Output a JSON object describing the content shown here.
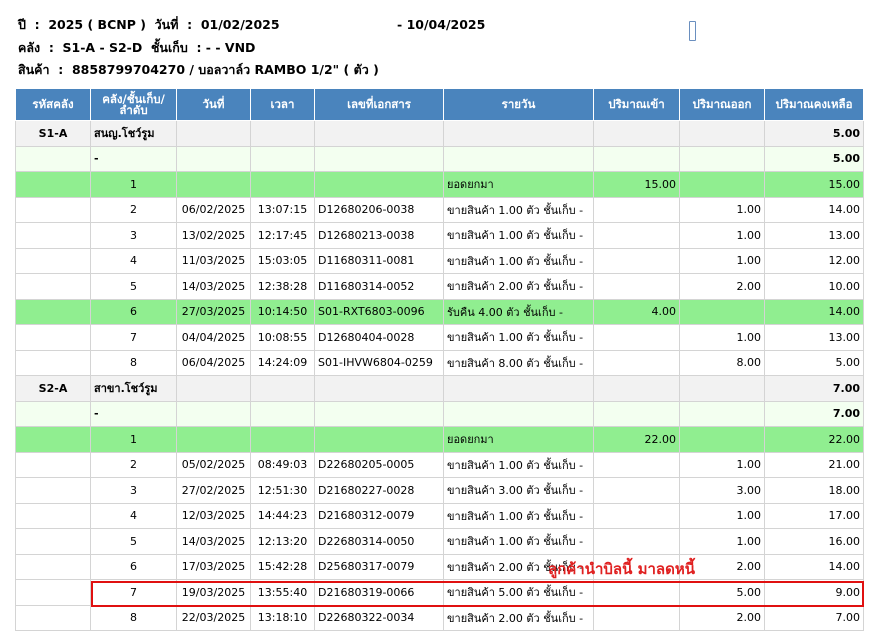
{
  "header": {
    "line1": "ปี  :  2025 ( BCNP )  วันที่  :  01/02/2025                           - 10/04/2025",
    "line2": "คลัง  :  S1-A - S2-D  ชั้นเก็บ  : - - VND",
    "line3": "สินค้า  :  8858799704270 / บอลวาล์ว RAMBO 1/2\" ( ตัว )"
  },
  "table": {
    "columns": [
      "รหัสคลัง",
      "คลัง/ชั้นเก็บ/ลำดับ",
      "วันที่",
      "เวลา",
      "เลขที่เอกสาร",
      "รายวัน",
      "ปริมาณเข้า",
      "ปริมาณออก",
      "ปริมาณคงเหลือ"
    ],
    "rows": [
      {
        "kind": "grp",
        "code": "S1-A",
        "loc": "สนญ.โชว์รูม",
        "date": "",
        "time": "",
        "doc": "",
        "desc": "",
        "in": "",
        "out": "",
        "bal": "5.00"
      },
      {
        "kind": "sub",
        "code": "",
        "loc": "-",
        "date": "",
        "time": "",
        "doc": "",
        "desc": "",
        "in": "",
        "out": "",
        "bal": "5.00"
      },
      {
        "kind": "open",
        "code": "",
        "loc": "1",
        "date": "",
        "time": "",
        "doc": "",
        "desc": "ยอดยกมา",
        "in": "15.00",
        "out": "",
        "bal": "15.00"
      },
      {
        "kind": "norm",
        "code": "",
        "loc": "2",
        "date": "06/02/2025",
        "time": "13:07:15",
        "doc": "D12680206-0038",
        "desc": "ขายสินค้า 1.00 ตัว ชั้นเก็บ -",
        "in": "",
        "out": "1.00",
        "bal": "14.00"
      },
      {
        "kind": "norm",
        "code": "",
        "loc": "3",
        "date": "13/02/2025",
        "time": "12:17:45",
        "doc": "D12680213-0038",
        "desc": "ขายสินค้า 1.00 ตัว ชั้นเก็บ -",
        "in": "",
        "out": "1.00",
        "bal": "13.00"
      },
      {
        "kind": "norm",
        "code": "",
        "loc": "4",
        "date": "11/03/2025",
        "time": "15:03:05",
        "doc": "D11680311-0081",
        "desc": "ขายสินค้า 1.00 ตัว ชั้นเก็บ -",
        "in": "",
        "out": "1.00",
        "bal": "12.00"
      },
      {
        "kind": "norm",
        "code": "",
        "loc": "5",
        "date": "14/03/2025",
        "time": "12:38:28",
        "doc": "D11680314-0052",
        "desc": "ขายสินค้า 2.00 ตัว ชั้นเก็บ -",
        "in": "",
        "out": "2.00",
        "bal": "10.00"
      },
      {
        "kind": "ret",
        "code": "",
        "loc": "6",
        "date": "27/03/2025",
        "time": "10:14:50",
        "doc": "S01-RXT6803-0096",
        "desc": "รับคืน 4.00 ตัว ชั้นเก็บ -",
        "in": "4.00",
        "out": "",
        "bal": "14.00"
      },
      {
        "kind": "norm",
        "code": "",
        "loc": "7",
        "date": "04/04/2025",
        "time": "10:08:55",
        "doc": "D12680404-0028",
        "desc": "ขายสินค้า 1.00 ตัว ชั้นเก็บ -",
        "in": "",
        "out": "1.00",
        "bal": "13.00"
      },
      {
        "kind": "norm",
        "code": "",
        "loc": "8",
        "date": "06/04/2025",
        "time": "14:24:09",
        "doc": "S01-IHVW6804-0259",
        "desc": "ขายสินค้า 8.00 ตัว ชั้นเก็บ -",
        "in": "",
        "out": "8.00",
        "bal": "5.00"
      },
      {
        "kind": "grp",
        "code": "S2-A",
        "loc": "สาขา.โชว์รูม",
        "date": "",
        "time": "",
        "doc": "",
        "desc": "",
        "in": "",
        "out": "",
        "bal": "7.00"
      },
      {
        "kind": "sub",
        "code": "",
        "loc": "-",
        "date": "",
        "time": "",
        "doc": "",
        "desc": "",
        "in": "",
        "out": "",
        "bal": "7.00"
      },
      {
        "kind": "open",
        "code": "",
        "loc": "1",
        "date": "",
        "time": "",
        "doc": "",
        "desc": "ยอดยกมา",
        "in": "22.00",
        "out": "",
        "bal": "22.00"
      },
      {
        "kind": "norm",
        "code": "",
        "loc": "2",
        "date": "05/02/2025",
        "time": "08:49:03",
        "doc": "D22680205-0005",
        "desc": "ขายสินค้า 1.00 ตัว ชั้นเก็บ -",
        "in": "",
        "out": "1.00",
        "bal": "21.00"
      },
      {
        "kind": "norm",
        "code": "",
        "loc": "3",
        "date": "27/02/2025",
        "time": "12:51:30",
        "doc": "D21680227-0028",
        "desc": "ขายสินค้า 3.00 ตัว ชั้นเก็บ -",
        "in": "",
        "out": "3.00",
        "bal": "18.00"
      },
      {
        "kind": "norm",
        "code": "",
        "loc": "4",
        "date": "12/03/2025",
        "time": "14:44:23",
        "doc": "D21680312-0079",
        "desc": "ขายสินค้า 1.00 ตัว ชั้นเก็บ -",
        "in": "",
        "out": "1.00",
        "bal": "17.00"
      },
      {
        "kind": "norm",
        "code": "",
        "loc": "5",
        "date": "14/03/2025",
        "time": "12:13:20",
        "doc": "D22680314-0050",
        "desc": "ขายสินค้า 1.00 ตัว ชั้นเก็บ -",
        "in": "",
        "out": "1.00",
        "bal": "16.00"
      },
      {
        "kind": "norm",
        "code": "",
        "loc": "6",
        "date": "17/03/2025",
        "time": "15:42:28",
        "doc": "D25680317-0079",
        "desc": "ขายสินค้า 2.00 ตัว ชั้นเก็บ -",
        "in": "",
        "out": "2.00",
        "bal": "14.00"
      },
      {
        "kind": "norm",
        "code": "",
        "loc": "7",
        "date": "19/03/2025",
        "time": "13:55:40",
        "doc": "D21680319-0066",
        "desc": "ขายสินค้า 5.00 ตัว ชั้นเก็บ -",
        "in": "",
        "out": "5.00",
        "bal": "9.00"
      },
      {
        "kind": "norm",
        "code": "",
        "loc": "8",
        "date": "22/03/2025",
        "time": "13:18:10",
        "doc": "D22680322-0034",
        "desc": "ขายสินค้า 2.00 ตัว ชั้นเก็บ -",
        "in": "",
        "out": "2.00",
        "bal": "7.00"
      }
    ]
  },
  "annotation": {
    "note": "ลูกค้านำบิลนี้ มาลดหนี้"
  }
}
